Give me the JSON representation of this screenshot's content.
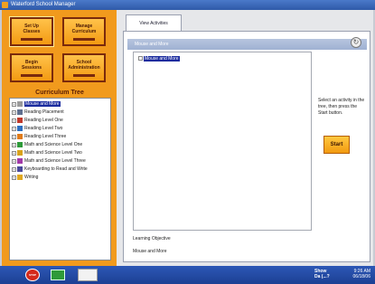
{
  "window": {
    "title": "Waterford School Manager"
  },
  "left": {
    "buttons": [
      {
        "line1": "Set Up",
        "line2": "Classes"
      },
      {
        "line1": "Manage",
        "line2": "Curriculum"
      },
      {
        "line1": "Begin",
        "line2": "Sessions"
      },
      {
        "line1": "School",
        "line2": "Administration"
      }
    ],
    "tree_title": "Curriculum Tree",
    "tree": [
      {
        "label": "Mouse and More",
        "selected": true,
        "color": "#9a9a9a"
      },
      {
        "label": "Reading Placement",
        "color": "#5f6f8f"
      },
      {
        "label": "Reading Level One",
        "color": "#c0392b"
      },
      {
        "label": "Reading Level Two",
        "color": "#2e6fc0"
      },
      {
        "label": "Reading Level Three",
        "color": "#e07b1a"
      },
      {
        "label": "Math and Science Level One",
        "color": "#2e9a3a"
      },
      {
        "label": "Math and Science Level Two",
        "color": "#d9a21a"
      },
      {
        "label": "Math and Science Level Three",
        "color": "#a23aa8"
      },
      {
        "label": "Keyboarding to Read and Write",
        "color": "#4a4a9a"
      },
      {
        "label": "Writing",
        "color": "#e0a820"
      }
    ]
  },
  "tabs": [
    {
      "label": "View Activities"
    }
  ],
  "panel": {
    "header": "Mouse and More",
    "activity_item": "Mouse and More",
    "instructions": "Select an activity in the tree, then press the Start button.",
    "start_label": "Start",
    "objective_label": "Learning Objective",
    "objective_value": "Mouse and More"
  },
  "taskbar": {
    "user_line1": "Show",
    "user_line2": "Da (...?",
    "time": "9:26 AM",
    "date": "06/18/06",
    "stop_label": "STOP"
  }
}
